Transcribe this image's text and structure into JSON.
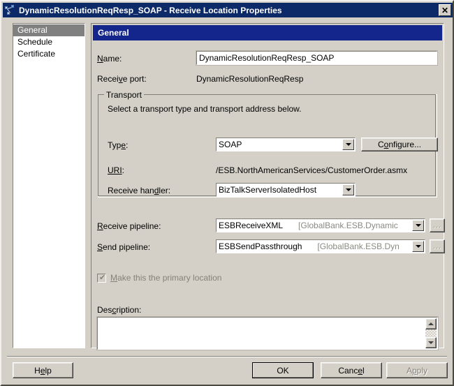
{
  "window": {
    "title": "DynamicResolutionReqResp_SOAP - Receive Location Properties",
    "icon": "receive-location-icon",
    "close_label": "✕"
  },
  "sidebar": {
    "items": [
      {
        "label": "General",
        "selected": true
      },
      {
        "label": "Schedule",
        "selected": false
      },
      {
        "label": "Certificate",
        "selected": false
      }
    ]
  },
  "panel": {
    "header": "General",
    "name": {
      "label_prefix": "N",
      "label_rest": "ame:",
      "value": "DynamicResolutionReqResp_SOAP",
      "placeholder": ""
    },
    "receive_port": {
      "label_a": "Recei",
      "label_b": "v",
      "label_c": "e port:",
      "value": "DynamicResolutionReqResp"
    },
    "transport": {
      "legend": "Transport",
      "description": "Select a transport type and transport address below.",
      "type": {
        "label_a": "Typ",
        "label_b": "e",
        "label_c": ":",
        "value": "SOAP"
      },
      "configure_button": {
        "label_a": "C",
        "label_b": "o",
        "label_c": "nfigure..."
      },
      "uri": {
        "label_a": "URI",
        "label_b": ":",
        "value": "/ESB.NorthAmericanServices/CustomerOrder.asmx"
      },
      "receive_handler": {
        "label_a": "Receive han",
        "label_b": "d",
        "label_c": "ler:",
        "value": "BizTalkServerIsolatedHost"
      }
    },
    "receive_pipeline": {
      "label_a": "R",
      "label_b": "e",
      "label_c": "ceive pipeline:",
      "value": "ESBReceiveXML",
      "assembly": "[GlobalBank.ESB.Dynamic",
      "browse_label": "..."
    },
    "send_pipeline": {
      "label_a": "S",
      "label_b": "e",
      "label_c": "nd pipeline:",
      "value": "ESBSendPassthrough",
      "assembly": "[GlobalBank.ESB.Dyn",
      "browse_label": "..."
    },
    "primary_location": {
      "label_a": "M",
      "label_b": "a",
      "label_c": "ke this the primary location",
      "checked": true,
      "enabled": false,
      "check_glyph": "✔"
    },
    "description": {
      "label_a": "Des",
      "label_b": "c",
      "label_c": "ription:",
      "value": "",
      "scroll_up": "▲",
      "scroll_down": "▼"
    }
  },
  "footer": {
    "help": {
      "label_a": "H",
      "label_b": "e",
      "label_c": "lp"
    },
    "ok": "OK",
    "cancel": {
      "label_a": "Canc",
      "label_b": "e",
      "label_c": "l"
    },
    "apply": {
      "label_a": "A",
      "label_b": "p",
      "label_c": "ply",
      "enabled": false
    }
  },
  "colors": {
    "titlebar": "#0d2a68",
    "panel_header": "#14268c",
    "dialog_bg": "#d4d0c8",
    "selection": "#808080"
  }
}
